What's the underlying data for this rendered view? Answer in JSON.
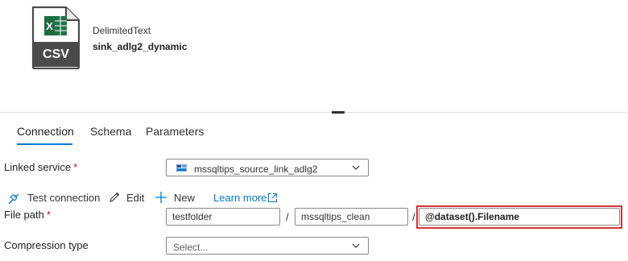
{
  "dataset": {
    "type": "DelimitedText",
    "name": "sink_adlg2_dynamic",
    "icon": "csv-file-icon",
    "icon_text": "CSV",
    "icon_color": "#217346"
  },
  "tabs": [
    {
      "label": "Connection",
      "active": true
    },
    {
      "label": "Schema",
      "active": false
    },
    {
      "label": "Parameters",
      "active": false
    }
  ],
  "connection": {
    "linked_service": {
      "label": "Linked service",
      "required_mark": "*",
      "value": "mssqltips_source_link_adlg2",
      "icon": "storage-account-icon"
    },
    "toolbar": {
      "test_connection": "Test connection",
      "edit": "Edit",
      "new": "New",
      "learn_more": "Learn more"
    },
    "file_path": {
      "label": "File path",
      "required_mark": "*",
      "container": "testfolder",
      "directory": "mssqltips_clean",
      "file": "@dataset().Filename",
      "separator": "/"
    },
    "compression": {
      "label": "Compression type",
      "placeholder": "Select..."
    }
  },
  "colors": {
    "accent": "#0078d4",
    "highlight_border": "#d13438",
    "required": "#c50f1f"
  }
}
